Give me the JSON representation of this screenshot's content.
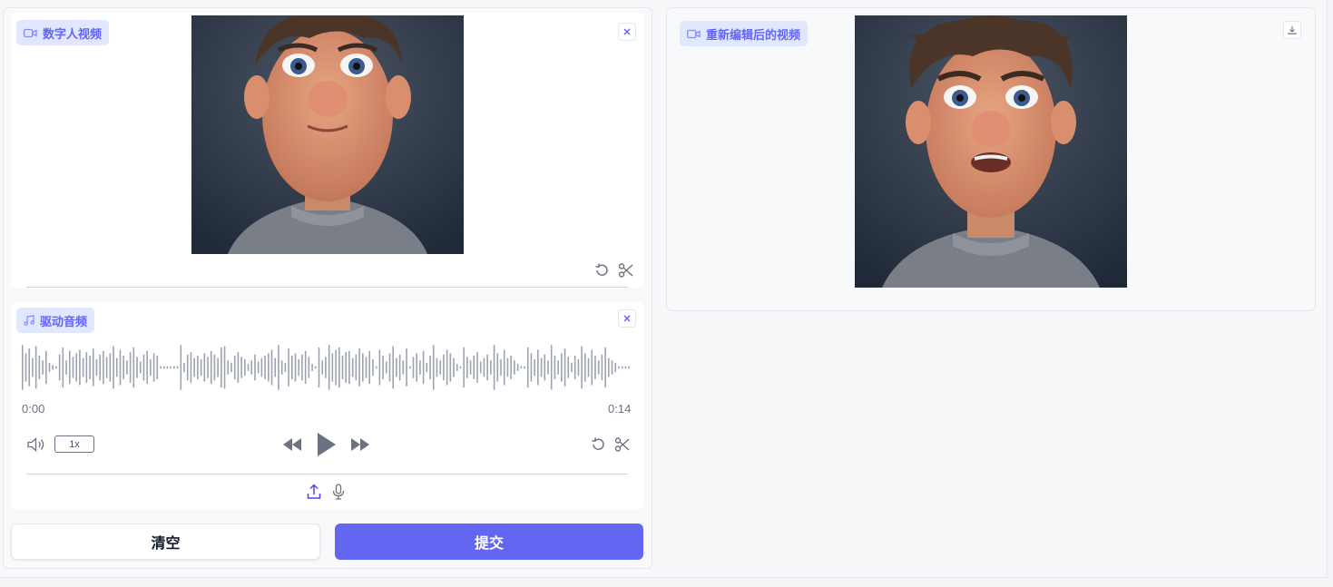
{
  "input_video": {
    "label": "数字人视频",
    "label_icon": "video-camera-icon",
    "close_icon": "close-icon",
    "undo_icon": "undo-icon",
    "trim_icon": "scissors-icon"
  },
  "audio": {
    "label": "驱动音频",
    "label_icon": "music-note-icon",
    "close_icon": "close-icon",
    "time_start": "0:00",
    "time_end": "0:14",
    "playback_rate": "1x",
    "volume_icon": "volume-icon",
    "rewind_icon": "rewind-icon",
    "play_icon": "play-icon",
    "forward_icon": "fast-forward-icon",
    "undo_icon": "undo-icon",
    "trim_icon": "scissors-icon",
    "upload_icon": "upload-icon",
    "mic_icon": "microphone-icon",
    "waveform_amplitudes": [
      0.95,
      0.6,
      0.8,
      0.4,
      0.9,
      0.5,
      0.3,
      0.7,
      0.2,
      0.1,
      0.05,
      0.55,
      0.85,
      0.3,
      0.7,
      0.45,
      0.6,
      0.75,
      0.4,
      0.65,
      0.5,
      0.8,
      0.35,
      0.55,
      0.7,
      0.45,
      0.6,
      0.9,
      0.4,
      0.75,
      0.5,
      0.3,
      0.65,
      0.85,
      0.45,
      0.25,
      0.55,
      0.7,
      0.35,
      0.6,
      0.5,
      0.05,
      0.05,
      0.05,
      0.05,
      0.05,
      0.05,
      0.95,
      0.2,
      0.55,
      0.65,
      0.4,
      0.5,
      0.35,
      0.6,
      0.45,
      0.7,
      0.55,
      0.4,
      0.85,
      0.9,
      0.3,
      0.2,
      0.5,
      0.65,
      0.45,
      0.35,
      0.15,
      0.3,
      0.55,
      0.25,
      0.4,
      0.5,
      0.6,
      0.75,
      0.4,
      0.95,
      0.3,
      0.2,
      0.8,
      0.5,
      0.6,
      0.35,
      0.55,
      0.7,
      0.45,
      0.15,
      0.05,
      0.85,
      0.3,
      0.45,
      0.95,
      0.6,
      0.75,
      0.85,
      0.5,
      0.65,
      0.7,
      0.4,
      0.55,
      0.8,
      0.6,
      0.45,
      0.7,
      0.35,
      0.05,
      0.75,
      0.5,
      0.25,
      0.6,
      0.9,
      0.4,
      0.55,
      0.3,
      0.8,
      0.05,
      0.45,
      0.6,
      0.3,
      0.7,
      0.2,
      0.5,
      0.95,
      0.4,
      0.3,
      0.55,
      0.75,
      0.6,
      0.4,
      0.15,
      0.05,
      0.85,
      0.45,
      0.3,
      0.5,
      0.65,
      0.25,
      0.4,
      0.55,
      0.3,
      0.95,
      0.6,
      0.35,
      0.75,
      0.4,
      0.5,
      0.3,
      0.15,
      0.05,
      0.05,
      0.85,
      0.6,
      0.35,
      0.75,
      0.4,
      0.55,
      0.3,
      0.95,
      0.5,
      0.3,
      0.6,
      0.8,
      0.45,
      0.2,
      0.5,
      0.35,
      0.9,
      0.6,
      0.4,
      0.75,
      0.5,
      0.3,
      0.55,
      0.85,
      0.4,
      0.3,
      0.2,
      0.05,
      0.05,
      0.05,
      0.05
    ]
  },
  "output_video": {
    "label": "重新编辑后的视频",
    "label_icon": "video-camera-icon",
    "download_icon": "download-icon"
  },
  "actions": {
    "clear_label": "清空",
    "submit_label": "提交"
  },
  "colors": {
    "accent": "#6366f1",
    "chip_bg": "#e0e7ff",
    "panel_bg": "#f8f9fb",
    "waveform": "#9ca3af"
  }
}
